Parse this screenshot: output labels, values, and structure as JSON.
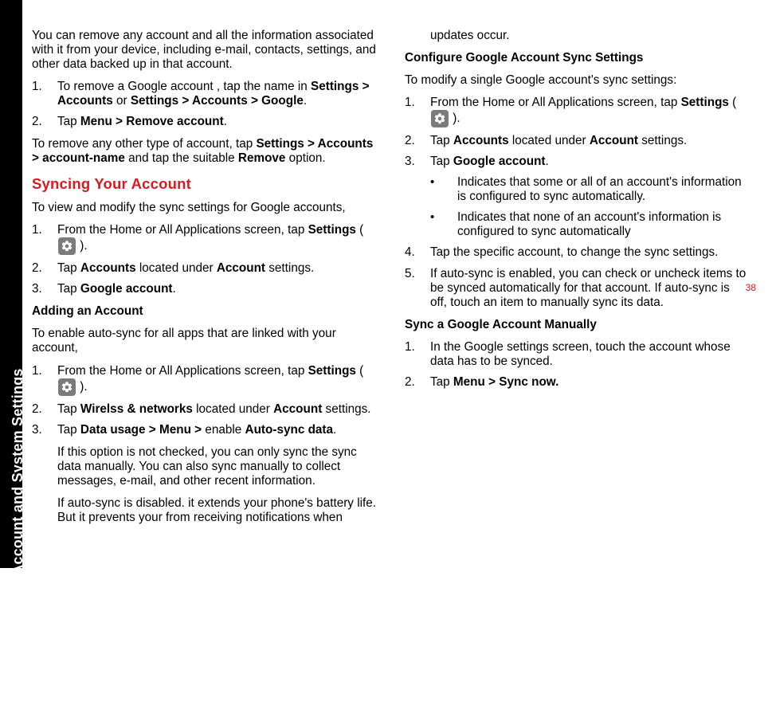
{
  "sidebar": {
    "title": "Managing Personal, Account and System Settings"
  },
  "pageNumber": "38",
  "left": {
    "intro": "You can remove any account and all the information associated with it from your device, including e-mail, contacts, settings, and other data backed up in that account.",
    "step1_pre": "To remove a Google account , tap the name in ",
    "step1_b1": "Settings > Accounts",
    "step1_mid": " or ",
    "step1_b2": "Settings > Accounts > Google",
    "step1_post": ".",
    "step2_pre": "Tap ",
    "step2_b": "Menu > Remove account",
    "step2_post": ".",
    "otherRemove_pre": "To remove any other type of account, tap ",
    "otherRemove_b1": "Settings > Accounts > account-name",
    "otherRemove_mid": " and tap the suitable ",
    "otherRemove_b2": "Remove",
    "otherRemove_post": " option.",
    "syncHeading": "Syncing Your Account",
    "syncIntro": "To view and modify the sync settings for Google accounts,",
    "sync1_pre": "From the Home or All Applications screen, tap ",
    "sync1_b": "Settings",
    "sync1_open": " ( ",
    "sync1_close": " ).",
    "sync2_pre": "Tap ",
    "sync2_b1": "Accounts",
    "sync2_mid": " located under ",
    "sync2_b2": "Account",
    "sync2_post": " settings.",
    "sync3_pre": "Tap ",
    "sync3_b": "Google account",
    "sync3_post": ".",
    "addHeading": "Adding an Account",
    "addIntro": "To enable auto-sync for all apps that are linked with your account,",
    "add1_pre": "From the Home or All Applications screen, tap ",
    "add1_b": "Settings",
    "add1_open": " ( ",
    "add1_close": " ).",
    "add2_pre": "Tap ",
    "add2_b1": "Wirelss & networks",
    "add2_mid": " located under ",
    "add2_b2": "Account",
    "add2_post": " settings.",
    "add3_pre": "Tap ",
    "add3_b1": "Data usage > Menu > ",
    "add3_mid": "enable ",
    "add3_b2": "Auto-sync data",
    "add3_post": "."
  },
  "right": {
    "note1": "If this option is not checked, you can only sync the sync data manually. You can also sync manually to collect messages, e-mail, and other recent information.",
    "note2": "If auto-sync is disabled. it extends your phone's battery life. But it prevents your from receiving notifications when updates occur.",
    "cfgHeading": "Configure Google Account Sync Settings",
    "cfgIntro": "To modify a single Google account's sync settings:",
    "cfg1_pre": "From the Home or All Applications screen, tap ",
    "cfg1_b": "Settings",
    "cfg1_open": " ( ",
    "cfg1_close": " ).",
    "cfg2_pre": "Tap ",
    "cfg2_b1": "Accounts",
    "cfg2_mid": " located under ",
    "cfg2_b2": "Account",
    "cfg2_post": " settings.",
    "cfg3_pre": "Tap ",
    "cfg3_b": "Google account",
    "cfg3_post": ".",
    "bullet1": "Indicates that some or all of an account's information is configured to sync automatically.",
    "bullet2": "Indicates that none of an account's information is configured to sync automatically",
    "cfg4": "Tap the specific account, to change the sync settings.",
    "cfg5": "If auto-sync is enabled, you can check or uncheck items to be synced automatically for that account. If auto-sync is off, touch an item to manually sync its data.",
    "manHeading": "Sync a Google Account Manually",
    "man1": "In the Google settings screen, touch the account whose data has to be synced.",
    "man2_pre": "Tap ",
    "man2_b": "Menu > Sync now."
  },
  "nums": {
    "n1": "1.",
    "n2": "2.",
    "n3": "3.",
    "n4": "4.",
    "n5": "5."
  },
  "bulletChar": "•"
}
